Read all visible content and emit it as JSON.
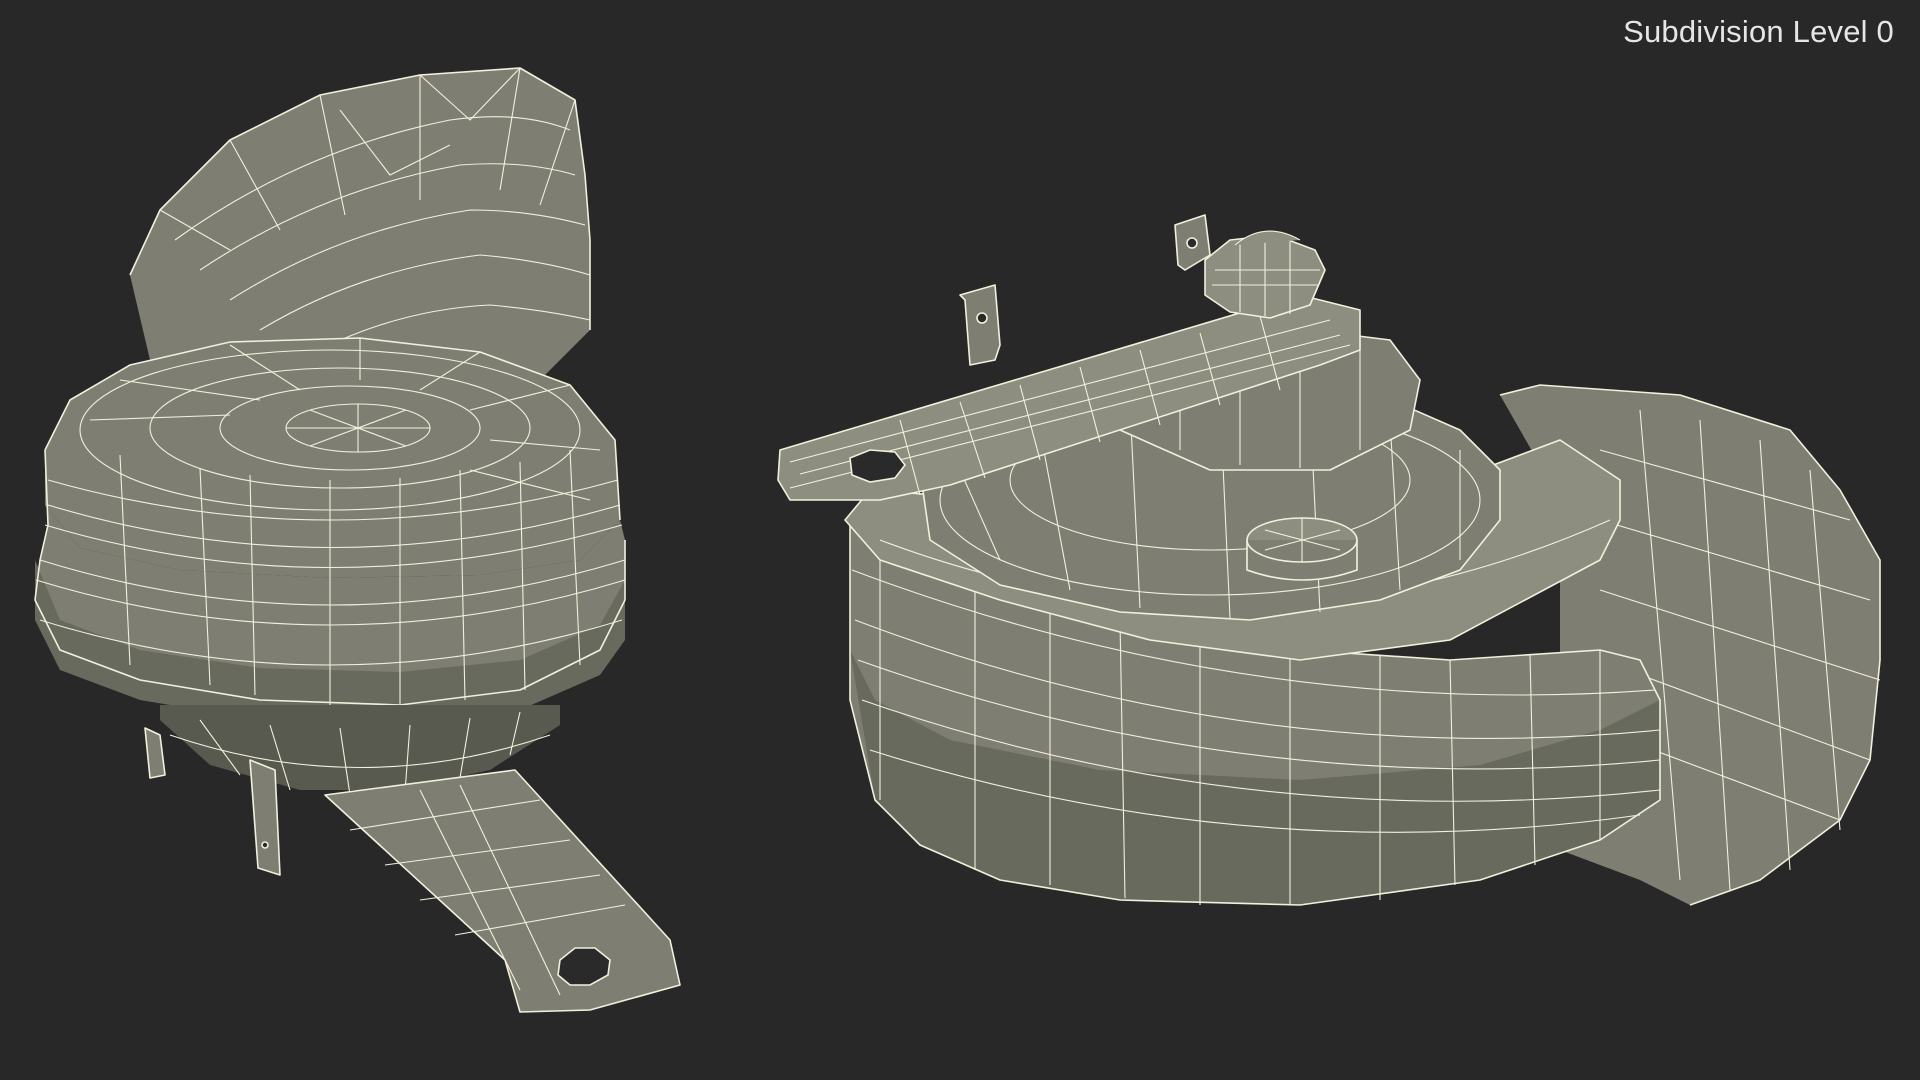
{
  "overlay": {
    "label": "Subdivision Level 0"
  },
  "scene": {
    "background_color": "#282828",
    "model_color": "#7e7f72",
    "wire_color": "#f2f0dc",
    "objects": [
      {
        "name": "snail-horn-rear-view"
      },
      {
        "name": "snail-horn-front-view"
      }
    ]
  }
}
